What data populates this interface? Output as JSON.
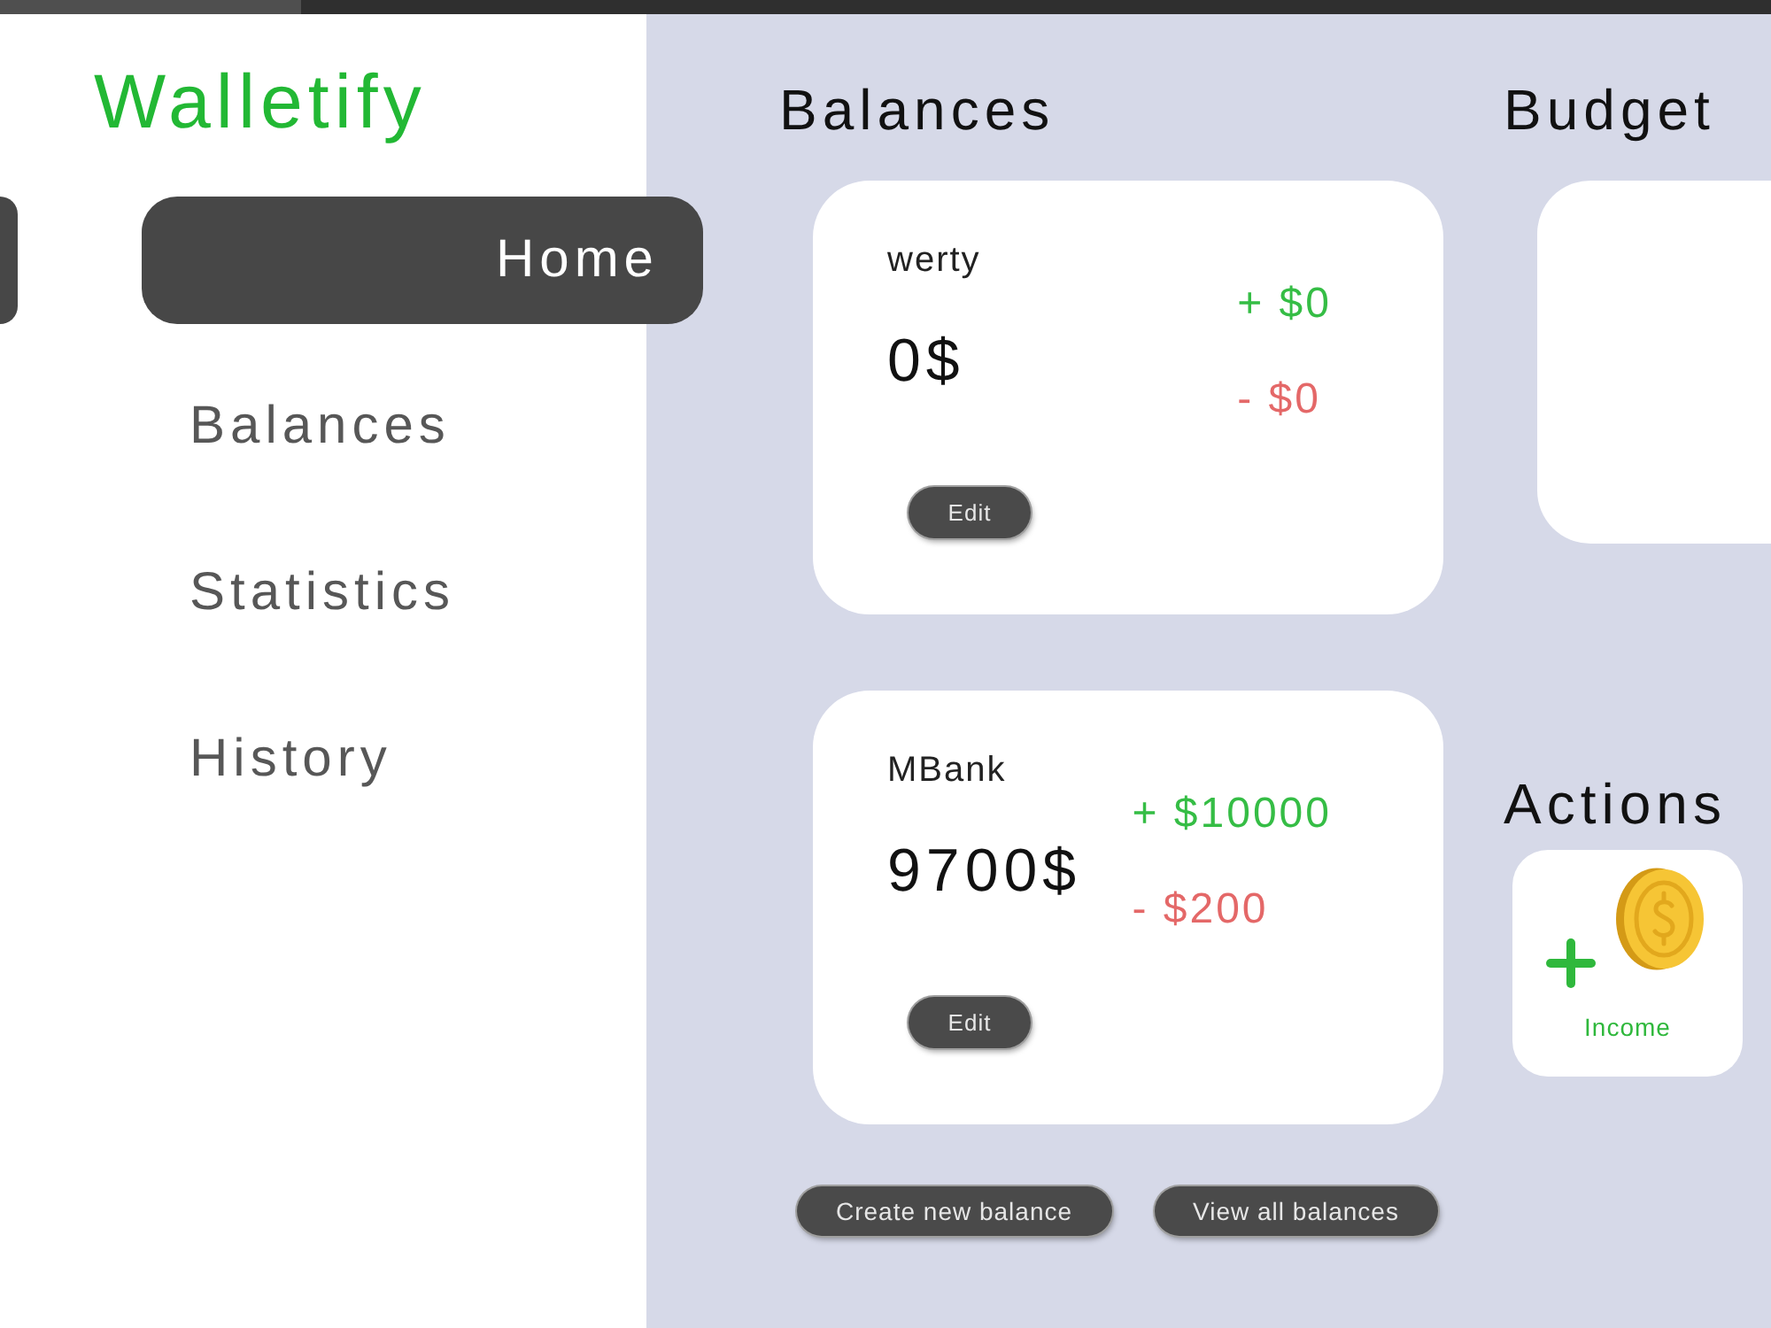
{
  "app": {
    "logo": "Walletify"
  },
  "nav": [
    {
      "label": "Home",
      "selected": true
    },
    {
      "label": "Balances",
      "selected": false
    },
    {
      "label": "Statistics",
      "selected": false
    },
    {
      "label": "History",
      "selected": false
    }
  ],
  "balances": {
    "title": "Balances",
    "cards": [
      {
        "name": "werty",
        "amount": "0$",
        "income": "+ $0",
        "expense": "- $0",
        "edit_button": "Edit"
      },
      {
        "name": "MBank",
        "amount": "9700$",
        "income": "+ $10000",
        "expense": "- $200",
        "edit_button": "Edit"
      }
    ],
    "create_button": "Create new balance",
    "view_all_button": "View all balances"
  },
  "budget": {
    "title": "Budget"
  },
  "actions": {
    "title": "Actions",
    "items": [
      {
        "kind": "income",
        "label": "Income"
      }
    ]
  }
}
